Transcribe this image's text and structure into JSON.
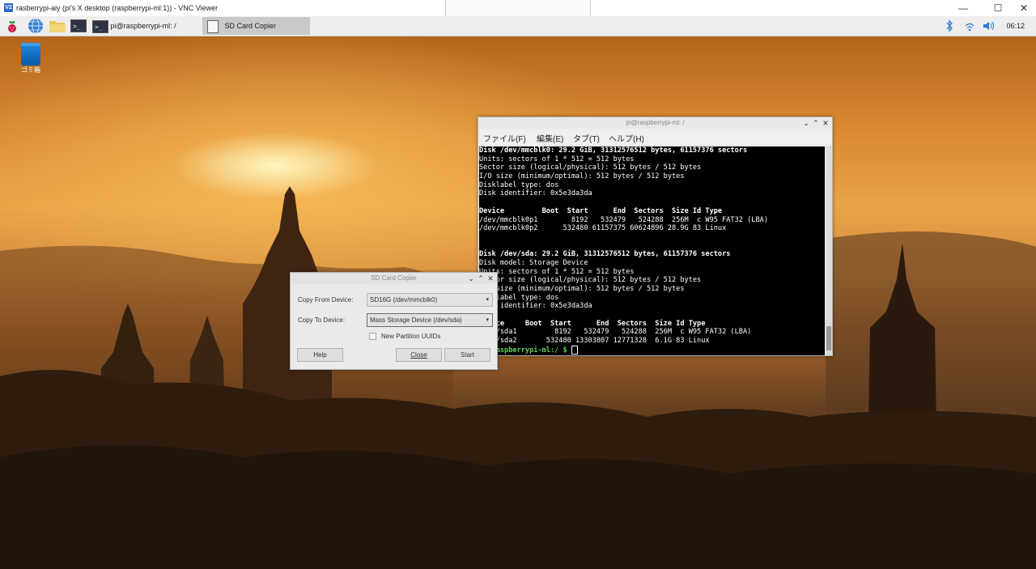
{
  "vnc": {
    "logo": "V2",
    "title": "rasberrypi-aiy (pi's X desktop (raspberrypi-ml:1)) - VNC Viewer",
    "controls": {
      "minimize": "—",
      "maximize": "☐",
      "close": "✕"
    }
  },
  "panel": {
    "tasks": [
      {
        "label": "pi@raspberrypi-ml: /"
      },
      {
        "label": "SD Card Copier"
      }
    ],
    "clock": "06:12"
  },
  "desktop": {
    "icons": [
      {
        "label": "ゴミ箱",
        "icon": "trash-icon"
      }
    ]
  },
  "terminal": {
    "title": "pi@raspberrypi-ml: /",
    "controls": {
      "minimize": "⌄",
      "maximize": "⌃",
      "close": "✕"
    },
    "menu": [
      "ファイル(F)",
      "編集(E)",
      "タブ(T)",
      "ヘルプ(H)"
    ],
    "lines": [
      {
        "text": "Disk /dev/mmcblk0: 29.2 GiB, 31312576512 bytes, 61157376 sectors",
        "bold": true
      },
      {
        "text": "Units: sectors of 1 * 512 = 512 bytes"
      },
      {
        "text": "Sector size (logical/physical): 512 bytes / 512 bytes"
      },
      {
        "text": "I/O size (minimum/optimal): 512 bytes / 512 bytes"
      },
      {
        "text": "Disklabel type: dos"
      },
      {
        "text": "Disk identifier: 0x5e3da3da"
      },
      {
        "text": ""
      },
      {
        "text": "Device         Boot  Start      End  Sectors  Size Id Type",
        "bold": true
      },
      {
        "text": "/dev/mmcblk0p1        8192   532479   524288  256M  c W95 FAT32 (LBA)"
      },
      {
        "text": "/dev/mmcblk0p2      532480 61157375 60624896 28.9G 83 Linux"
      },
      {
        "text": ""
      },
      {
        "text": ""
      },
      {
        "text": "Disk /dev/sda: 29.2 GiB, 31312576512 bytes, 61157376 sectors",
        "bold": true
      },
      {
        "text": "Disk model: Storage Device"
      },
      {
        "text": "Units: sectors of 1 * 512 = 512 bytes"
      },
      {
        "text": "Sector size (logical/physical): 512 bytes / 512 bytes"
      },
      {
        "text": "I/O size (minimum/optimal): 512 bytes / 512 bytes"
      },
      {
        "text": "Disklabel type: dos"
      },
      {
        "text": "Disk identifier: 0x5e3da3da"
      },
      {
        "text": ""
      },
      {
        "text": "Device     Boot  Start      End  Sectors  Size Id Type",
        "bold": true
      },
      {
        "text": "/dev/sda1         8192   532479   524288  256M  c W95 FAT32 (LBA)"
      },
      {
        "text": "/dev/sda2       532480 13303807 12771328  6.1G 83 Linux"
      }
    ],
    "prompt": "pi@raspberrypi-ml:/ $"
  },
  "dialog": {
    "title": "SD Card Copier",
    "controls": {
      "minimize": "⌄",
      "maximize": "⌃",
      "close": "✕"
    },
    "copy_from_label": "Copy From Device:",
    "copy_from_value": "SD16G (/dev/mmcblk0)",
    "copy_to_label": "Copy To Device:",
    "copy_to_value": "Mass Storage Device (/dev/sda)",
    "checkbox_label": "New Partition UUIDs",
    "checkbox_checked": false,
    "help_label": "Help",
    "close_label": "Close",
    "start_label": "Start"
  }
}
